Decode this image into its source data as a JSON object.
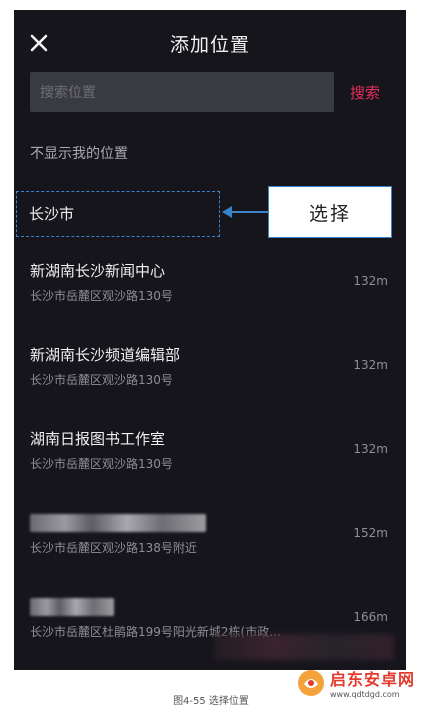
{
  "header": {
    "title": "添加位置",
    "close_icon": "close-icon"
  },
  "search": {
    "placeholder": "搜索位置",
    "button_label": "搜索"
  },
  "no_location": "不显示我的位置",
  "city": {
    "label": "长沙市"
  },
  "annotation": {
    "label": "选择"
  },
  "items": [
    {
      "name": "新湖南长沙新闻中心",
      "address": "长沙市岳麓区观沙路130号",
      "distance": "132m"
    },
    {
      "name": "新湖南长沙频道编辑部",
      "address": "长沙市岳麓区观沙路130号",
      "distance": "132m"
    },
    {
      "name": "湖南日报图书工作室",
      "address": "长沙市岳麓区观沙路130号",
      "distance": "132m"
    },
    {
      "address": "长沙市岳麓区观沙路138号附近",
      "distance": "152m"
    },
    {
      "address": "长沙市岳麓区杜鹃路199号阳光新城2栋(市政...",
      "distance": "166m"
    }
  ],
  "caption": "图4-55  选择位置",
  "watermark": {
    "name": "启东安卓网",
    "url": "www.qdtdgd.com"
  },
  "colors": {
    "accent": "#e4305a",
    "annotation_blue": "#3a83c8",
    "background": "#16151c"
  }
}
